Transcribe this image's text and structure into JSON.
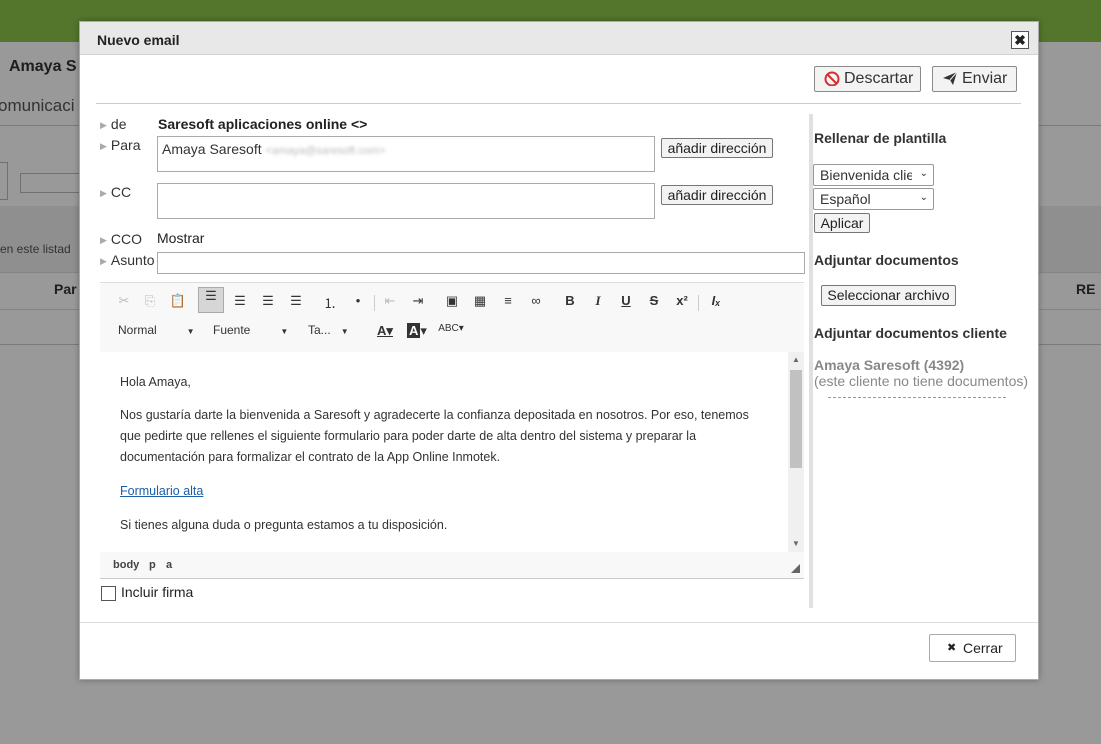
{
  "background": {
    "user_name": "Amaya S",
    "section": "omunicaci",
    "list_hint": "en este listad",
    "col_left": "Par",
    "col_right": "RE"
  },
  "dialog": {
    "title": "Nuevo email",
    "close_glyph": "✖",
    "discard_label": "Descartar",
    "send_label": "Enviar",
    "close_label": "Cerrar"
  },
  "form": {
    "from_label": "de",
    "from_value": "Saresoft aplicaciones online <>",
    "to_label": "Para",
    "to_value_name": "Amaya Saresoft",
    "to_value_email": "<amaya@saresoft.com>",
    "cc_label": "CC",
    "bcc_label": "CCO",
    "bcc_show": "Mostrar",
    "subject_label": "Asunto",
    "add_address_label": "añadir dirección",
    "signature_label": "Incluir firma"
  },
  "editor": {
    "format_combo": "Normal",
    "font_combo": "Fuente",
    "size_combo": "Ta...",
    "greeting": "Hola Amaya,",
    "paragraph1": "Nos gustaría darte la bienvenida a Saresoft y agradecerte la confianza depositada en nosotros. Por eso, tenemos que pedirte que rellenes el siguiente formulario para poder darte de alta dentro del sistema y preparar la documentación para formalizar el contrato de la App Online Inmotek.",
    "link_text": "Formulario alta",
    "closing": "Si tienes alguna duda o pregunta estamos a tu disposición.",
    "path": [
      "body",
      "p",
      "a"
    ]
  },
  "sidebar": {
    "template_heading": "Rellenar de plantilla",
    "template_select": "Bienvenida cliente",
    "language_select": "Español",
    "apply_label": "Aplicar",
    "attach_heading": "Adjuntar documentos",
    "file_button": "Seleccionar archivo",
    "client_docs_heading": "Adjuntar documentos cliente",
    "client_name": "Amaya Saresoft (4392)",
    "client_note": "(este cliente no tiene documentos)"
  },
  "colors": {
    "topbar": "#8bc34a",
    "link": "#1a5fa8",
    "discard_icon": "#d32f2f"
  }
}
